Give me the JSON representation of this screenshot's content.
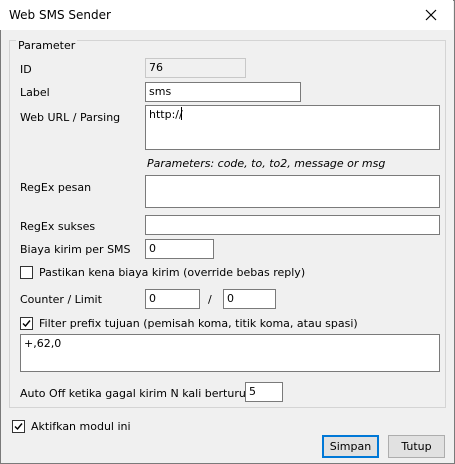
{
  "window": {
    "title": "Web SMS Sender",
    "close_icon": "close-icon"
  },
  "group": {
    "title": "Parameter"
  },
  "fields": {
    "id": {
      "label": "ID",
      "value": "76"
    },
    "label": {
      "label": "Label",
      "value": "sms"
    },
    "url": {
      "label": "Web URL / Parsing",
      "value": "http://",
      "hint": "Parameters: code, to, to2, message or msg"
    },
    "regex_message": {
      "label": "RegEx pesan",
      "value": ""
    },
    "regex_success": {
      "label": "RegEx sukses",
      "value": ""
    },
    "cost": {
      "label": "Biaya kirim per SMS",
      "value": "0"
    },
    "ensure_cost": {
      "label": "Pastikan kena biaya kirim (override bebas reply)",
      "checked": false
    },
    "counter": {
      "label": "Counter / Limit",
      "counter_value": "0",
      "separator": "/",
      "limit_value": "0"
    },
    "prefix_filter": {
      "label": "Filter prefix tujuan (pemisah koma, titik koma, atau spasi)",
      "checked": true,
      "value": "+,62,0"
    },
    "auto_off": {
      "label": "Auto Off ketika gagal kirim N kali berturut-turut",
      "value": "5"
    }
  },
  "enable_module": {
    "label": "Aktifkan modul ini",
    "checked": true
  },
  "buttons": {
    "save": "Simpan",
    "close": "Tutup"
  }
}
